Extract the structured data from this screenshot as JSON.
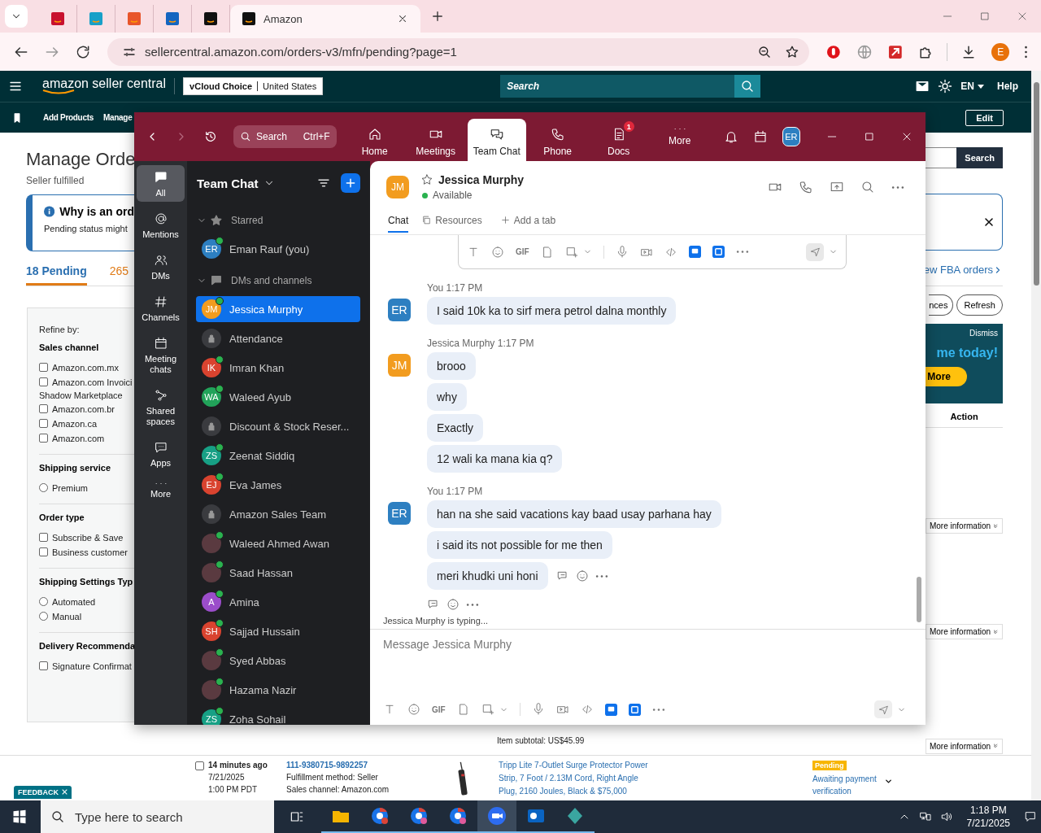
{
  "browser": {
    "tabs": [
      {
        "selected": false
      },
      {
        "selected": false
      },
      {
        "selected": false
      },
      {
        "selected": false
      },
      {
        "selected": false
      },
      {
        "title": "Amazon",
        "selected": true
      }
    ],
    "url": "sellercentral.amazon.com/orders-v3/mfn/pending?page=1",
    "profile": "E"
  },
  "seller_header": {
    "logo": "amazon seller central",
    "store": "vCloud Choice",
    "region": "United States",
    "search_placeholder": "Search",
    "language": "EN",
    "help": "Help"
  },
  "subnav": {
    "items": [
      "Add Products",
      "Manage"
    ],
    "edit": "Edit"
  },
  "orders": {
    "title": "Manage Orde",
    "subtitle": "Seller fulfilled",
    "notice": {
      "title": "Why is an ord",
      "text": "Pending status might"
    },
    "tabs": [
      {
        "label": "18 Pending",
        "selected": true
      },
      {
        "label": "265",
        "selected": false
      }
    ],
    "refine": "Refine by:",
    "filters": [
      {
        "heading": "Sales channel",
        "options": [
          {
            "kind": "checkbox",
            "label": "Amazon.com.mx",
            "checked": false
          },
          {
            "kind": "checkbox",
            "label": "Amazon.com Invoici",
            "continuation": "Shadow Marketplace",
            "checked": false
          },
          {
            "kind": "checkbox",
            "label": "Amazon.com.br",
            "checked": false
          },
          {
            "kind": "checkbox",
            "label": "Amazon.ca",
            "checked": false
          },
          {
            "kind": "checkbox",
            "label": "Amazon.com",
            "checked": false
          }
        ]
      },
      {
        "heading": "Shipping service",
        "options": [
          {
            "kind": "radio",
            "label": "Premium",
            "selected": false
          }
        ]
      },
      {
        "heading": "Order type",
        "options": [
          {
            "kind": "checkbox",
            "label": "Subscribe & Save",
            "checked": false
          },
          {
            "kind": "checkbox",
            "label": "Business customer",
            "checked": false
          }
        ]
      },
      {
        "heading": "Shipping Settings Typ",
        "options": [
          {
            "kind": "radio",
            "label": "Automated",
            "selected": false
          },
          {
            "kind": "radio",
            "label": "Manual",
            "selected": false
          }
        ]
      },
      {
        "heading": "Delivery Recommenda",
        "options": [
          {
            "kind": "checkbox",
            "label": "Signature Confirmat",
            "checked": false
          }
        ]
      }
    ]
  },
  "orders_right": {
    "search_button": "Search",
    "fba_link": "ew FBA orders",
    "pills": [
      "nces",
      "Refresh"
    ],
    "promo": {
      "dismiss": "Dismiss",
      "headline": "me today!",
      "button": "More"
    },
    "action_header": "Action",
    "more_info": [
      "More information",
      "More information"
    ]
  },
  "order_row": {
    "subtotal": "Item subtotal: US$45.99",
    "more_info": "More information",
    "checked": false,
    "age": "14 minutes ago",
    "date": "7/21/2025",
    "time": "1:00 PM PDT",
    "order_id": "111-9380715-9892257",
    "fulfillment": "Fulfillment method: Seller",
    "channel": "Sales channel: Amazon.com",
    "product": "Tripp Lite 7-Outlet Surge Protector Power Strip, 7 Foot / 2.13M Cord, Right Angle Plug, 2160 Joules, Black & $75,000",
    "status": "Pending",
    "status_text": "Awaiting payment verification"
  },
  "feedback": "FEEDBACK",
  "zoom": {
    "search": "Search",
    "shortcut": "Ctrl+F",
    "avatar": "ER",
    "tabs": [
      {
        "label": "Home",
        "selected": false
      },
      {
        "label": "Meetings",
        "selected": false
      },
      {
        "label": "Team Chat",
        "selected": true
      },
      {
        "label": "Phone",
        "selected": false
      },
      {
        "label": "Docs",
        "selected": false,
        "badge": "1"
      },
      {
        "label": "More",
        "selected": false
      }
    ],
    "rail": [
      {
        "label": "All",
        "selected": true
      },
      {
        "label": "Mentions",
        "selected": false
      },
      {
        "label": "DMs",
        "selected": false
      },
      {
        "label": "Channels",
        "selected": false
      },
      {
        "label": "Meeting chats",
        "selected": false
      },
      {
        "label": "Shared spaces",
        "selected": false
      },
      {
        "label": "Apps",
        "selected": false
      },
      {
        "label": "More",
        "selected": false
      }
    ],
    "list_title": "Team Chat",
    "sections": [
      {
        "label": "Starred",
        "expanded": true,
        "items": [
          {
            "name": "Eman Rauf (you)",
            "kind": "initials",
            "initials": "ER",
            "color": "#2d7fc1",
            "online": true,
            "selected": false
          }
        ]
      },
      {
        "label": "DMs and channels",
        "expanded": true,
        "items": [
          {
            "name": "Jessica Murphy",
            "kind": "initials",
            "initials": "JM",
            "color": "#f29c1f",
            "online": true,
            "selected": true
          },
          {
            "name": "Attendance",
            "kind": "channel",
            "online": false,
            "selected": false
          },
          {
            "name": "Imran Khan",
            "kind": "initials",
            "initials": "IK",
            "color": "#d9432f",
            "online": true,
            "selected": false
          },
          {
            "name": "Waleed Ayub",
            "kind": "initials",
            "initials": "WA",
            "color": "#22a35a",
            "online": true,
            "selected": false
          },
          {
            "name": "Discount & Stock Reser...",
            "kind": "channel",
            "online": false,
            "selected": false
          },
          {
            "name": "Zeenat Siddiq",
            "kind": "initials",
            "initials": "ZS",
            "color": "#17a085",
            "online": true,
            "selected": false
          },
          {
            "name": "Eva James",
            "kind": "initials",
            "initials": "EJ",
            "color": "#d9432f",
            "online": true,
            "selected": false
          },
          {
            "name": "Amazon Sales Team",
            "kind": "channel",
            "online": false,
            "selected": false
          },
          {
            "name": "Waleed Ahmed Awan",
            "kind": "photo",
            "online": true,
            "selected": false
          },
          {
            "name": "Saad Hassan",
            "kind": "photo",
            "online": true,
            "selected": false
          },
          {
            "name": "Amina",
            "kind": "initials",
            "initials": "A",
            "color": "#9b4dca",
            "online": true,
            "selected": false
          },
          {
            "name": "Sajjad Hussain",
            "kind": "initials",
            "initials": "SH",
            "color": "#d9432f",
            "online": true,
            "selected": false
          },
          {
            "name": "Syed Abbas",
            "kind": "photo",
            "online": true,
            "selected": false
          },
          {
            "name": "Hazama Nazir",
            "kind": "photo",
            "online": true,
            "selected": false
          },
          {
            "name": "Zoha Sohail",
            "kind": "initials",
            "initials": "ZS",
            "color": "#17a085",
            "online": true,
            "selected": false
          }
        ]
      }
    ],
    "chat": {
      "avatar": "JM",
      "name": "Jessica Murphy",
      "status": "Available",
      "tabs": [
        {
          "label": "Chat",
          "selected": true
        },
        {
          "label": "Resources",
          "selected": false
        }
      ],
      "add_tab": "Add a tab",
      "toolbar_gif": "GIF",
      "groups": [
        {
          "sender": "You",
          "time": "1:17 PM",
          "avatar": "ER",
          "color": "#2d7fc1",
          "bubbles": [
            {
              "text": "I said 10k ka to sirf mera petrol dalna monthly",
              "hovered": false
            }
          ]
        },
        {
          "sender": "Jessica Murphy",
          "time": "1:17 PM",
          "avatar": "JM",
          "color": "#f29c1f",
          "bubbles": [
            {
              "text": "brooo",
              "hovered": false
            },
            {
              "text": "why",
              "hovered": false
            },
            {
              "text": "Exactly",
              "hovered": false
            },
            {
              "text": "12 wali ka mana kia q?",
              "hovered": false
            }
          ]
        },
        {
          "sender": "You",
          "time": "1:17 PM",
          "avatar": "ER",
          "color": "#2d7fc1",
          "bubbles": [
            {
              "text": "han na she said vacations kay baad usay parhana hay",
              "hovered": false
            },
            {
              "text": "i said its not possible for me then",
              "hovered": false
            },
            {
              "text": "meri khudki uni honi",
              "hovered": true
            }
          ]
        }
      ],
      "typing": "Jessica Murphy is typing...",
      "placeholder": "Message Jessica Murphy",
      "compose_gif": "GIF"
    }
  },
  "taskbar": {
    "search_placeholder": "Type here to search",
    "apps": [
      {
        "selected": false
      },
      {
        "selected": false
      },
      {
        "selected": false
      },
      {
        "selected": false
      },
      {
        "selected": true
      },
      {
        "selected": false
      },
      {
        "selected": false
      }
    ],
    "time": "1:18 PM",
    "date": "7/21/2025"
  }
}
